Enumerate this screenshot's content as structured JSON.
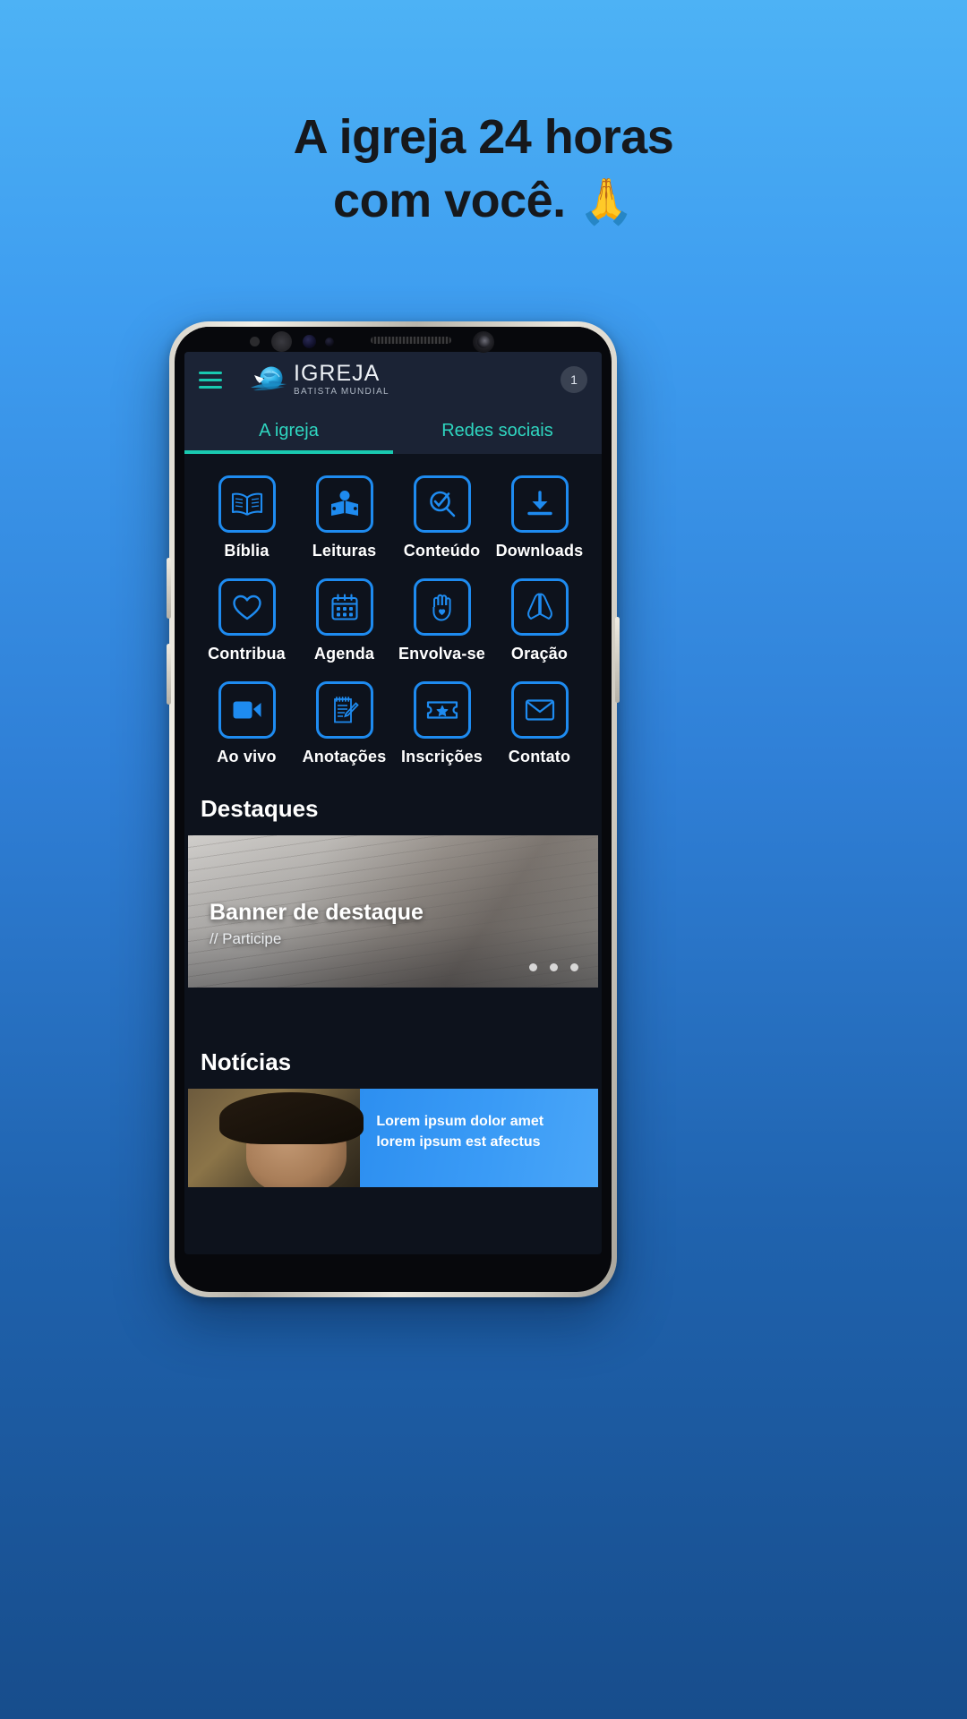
{
  "headline": {
    "line1": "A igreja 24 horas",
    "line2": "com você.",
    "emoji": "🙏"
  },
  "colors": {
    "background_top": "#4db2f5",
    "background_bottom": "#174d8c",
    "accent_teal": "#19c9b0",
    "accent_blue": "#1e8bf0",
    "screen_bg": "#0d121c",
    "appbar_bg": "#1b2335"
  },
  "app": {
    "appbar": {
      "menu_icon": "hamburger-menu-icon",
      "logo_icon": "globe-dove-logo-icon",
      "brand_name": "IGREJA",
      "brand_subtitle": "BATISTA MUNDIAL",
      "notification_count": "1"
    },
    "tabs": [
      {
        "label": "A igreja",
        "active": true
      },
      {
        "label": "Redes sociais",
        "active": false
      }
    ],
    "grid": [
      {
        "label": "Bíblia",
        "icon": "open-book-icon"
      },
      {
        "label": "Leituras",
        "icon": "person-reading-icon"
      },
      {
        "label": "Conteúdo",
        "icon": "magnifier-check-icon"
      },
      {
        "label": "Downloads",
        "icon": "download-arrow-icon"
      },
      {
        "label": "Contribua",
        "icon": "heart-icon"
      },
      {
        "label": "Agenda",
        "icon": "calendar-icon"
      },
      {
        "label": "Envolva-se",
        "icon": "raised-hand-heart-icon"
      },
      {
        "label": "Oração",
        "icon": "praying-hands-icon"
      },
      {
        "label": "Ao vivo",
        "icon": "video-camera-icon"
      },
      {
        "label": "Anotações",
        "icon": "notepad-pencil-icon"
      },
      {
        "label": "Inscrições",
        "icon": "ticket-star-icon"
      },
      {
        "label": "Contato",
        "icon": "envelope-icon"
      }
    ],
    "highlights": {
      "section_title": "Destaques",
      "banner_title": "Banner de destaque",
      "banner_subtitle": "// Participe",
      "carousel_dots": 3,
      "active_dot": 0
    },
    "news": {
      "section_title": "Notícias",
      "item_title": "Lorem ipsum dolor amet lorem ipsum est afectus"
    }
  }
}
